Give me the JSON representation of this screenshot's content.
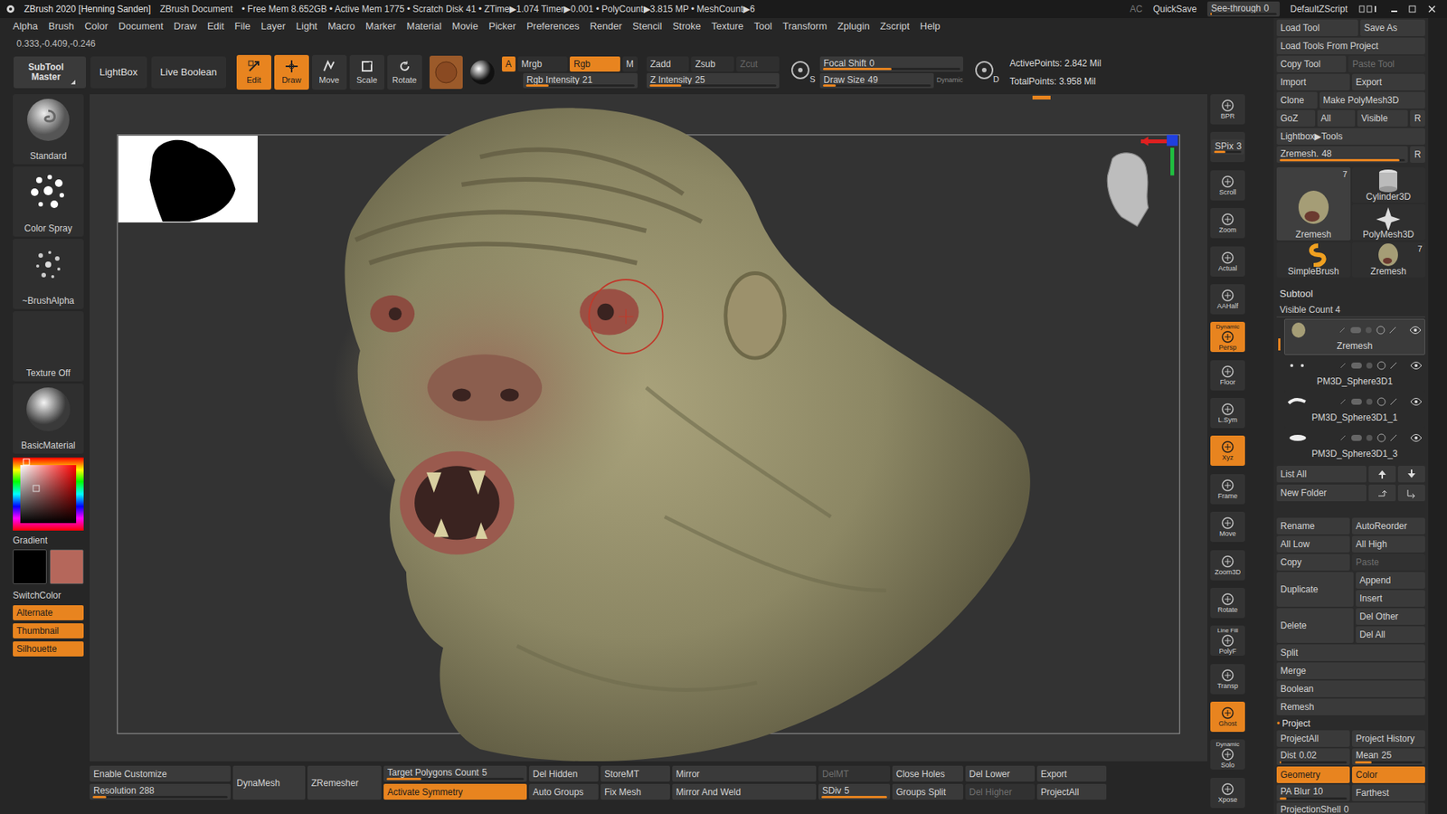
{
  "title_bar": {
    "app": "ZBrush 2020 [Henning Sanden]",
    "document": "ZBrush Document",
    "stats": "• Free Mem 8.652GB • Active Mem 1775 • Scratch Disk 41 • ZTime▶1.074 Timer▶0.001 • PolyCount▶3.815 MP • MeshCount▶6",
    "ac": "AC",
    "quicksave": "QuickSave",
    "see_through": {
      "label": "See-through",
      "value": "0",
      "level": 0
    },
    "script": "DefaultZScript"
  },
  "menu": [
    "Alpha",
    "Brush",
    "Color",
    "Document",
    "Draw",
    "Edit",
    "File",
    "Layer",
    "Light",
    "Macro",
    "Marker",
    "Material",
    "Movie",
    "Picker",
    "Preferences",
    "Render",
    "Stencil",
    "Stroke",
    "Texture",
    "Tool",
    "Transform",
    "Zplugin",
    "Zscript",
    "Help"
  ],
  "coordinates": "0.333,-0.409,-0.246",
  "top_shelf": {
    "palettes": [
      {
        "label": "SubTool Master"
      },
      {
        "label": "LightBox"
      },
      {
        "label": "Live Boolean"
      }
    ],
    "transform": [
      {
        "label": "Edit",
        "selected": true
      },
      {
        "label": "Draw",
        "selected": true
      },
      {
        "label": "Move",
        "selected": false
      },
      {
        "label": "Scale",
        "selected": false
      },
      {
        "label": "Rotate",
        "selected": false
      }
    ],
    "color_modes": [
      {
        "label": "A",
        "selected": true
      },
      {
        "label": "Mrgb",
        "selected": false
      },
      {
        "label": "Rgb",
        "selected": true
      },
      {
        "label": "M",
        "selected": false
      }
    ],
    "rgb_intensity": {
      "label": "Rgb Intensity",
      "value": "21",
      "level": 0.21
    },
    "depth_modes": [
      {
        "label": "Zadd",
        "selected": false,
        "disabled": false
      },
      {
        "label": "Zsub",
        "selected": false,
        "disabled": false
      },
      {
        "label": "Zcut",
        "selected": false,
        "disabled": true
      }
    ],
    "z_intensity": {
      "label": "Z Intensity",
      "value": "25",
      "level": 0.25
    },
    "focal_key": "S",
    "draw_key": "D",
    "focal_shift": {
      "label": "Focal Shift",
      "value": "0",
      "level": 0.5
    },
    "draw_size": {
      "label": "Draw Size",
      "value": "49",
      "level": 0.12
    },
    "dynamic": "Dynamic",
    "active_points": "ActivePoints: 2.842 Mil",
    "total_points": "TotalPoints: 3.958 Mil"
  },
  "left_shelf": {
    "brushes": [
      {
        "label": "Standard"
      },
      {
        "label": "Color Spray"
      },
      {
        "label": "~BrushAlpha"
      },
      {
        "label": "Texture Off"
      },
      {
        "label": "BasicMaterial"
      }
    ],
    "gradient": "Gradient",
    "swatches": [
      {
        "color": "#000000"
      },
      {
        "color": "#b5675b"
      }
    ],
    "switch_color": "SwitchColor",
    "toggles": [
      {
        "label": "Alternate",
        "on": true
      },
      {
        "label": "Thumbnail",
        "on": true
      },
      {
        "label": "Silhouette",
        "on": true
      }
    ]
  },
  "right_shelf": [
    {
      "label": "BPR",
      "caption": "",
      "kind": "button",
      "on": false
    },
    {
      "label": "SPix",
      "value": "3",
      "caption": "",
      "kind": "slider",
      "level": 0.43
    },
    {
      "label": "Scroll",
      "caption": "",
      "kind": "button",
      "on": false
    },
    {
      "label": "Zoom",
      "caption": "",
      "kind": "button",
      "on": false
    },
    {
      "label": "Actual",
      "caption": "",
      "kind": "button",
      "on": false
    },
    {
      "label": "AAHalf",
      "caption": "",
      "kind": "button",
      "on": false
    },
    {
      "label": "Persp",
      "caption": "Dynamic",
      "kind": "button",
      "on": true
    },
    {
      "label": "Floor",
      "caption": "",
      "kind": "button",
      "on": false
    },
    {
      "label": "L.Sym",
      "caption": "",
      "kind": "button",
      "on": false
    },
    {
      "label": "Xyz",
      "caption": "",
      "kind": "button",
      "on": true
    },
    {
      "label": "Frame",
      "caption": "",
      "kind": "button",
      "on": false
    },
    {
      "label": "Move",
      "caption": "",
      "kind": "button",
      "on": false
    },
    {
      "label": "Zoom3D",
      "caption": "",
      "kind": "button",
      "on": false
    },
    {
      "label": "Rotate",
      "caption": "",
      "kind": "button",
      "on": false
    },
    {
      "label": "PolyF",
      "caption": "Line Fill",
      "kind": "button",
      "on": false
    },
    {
      "label": "Transp",
      "caption": "",
      "kind": "button",
      "on": false
    },
    {
      "label": "Ghost",
      "caption": "",
      "kind": "button",
      "on": true
    },
    {
      "label": "Solo",
      "caption": "Dynamic",
      "kind": "button",
      "on": false
    },
    {
      "label": "Xpose",
      "caption": "",
      "kind": "button",
      "on": false
    }
  ],
  "tray": {
    "tool_rows": [
      {
        "items": [
          {
            "kind": "button",
            "label": "Load Tool"
          },
          {
            "kind": "button",
            "label": "Save As"
          }
        ]
      },
      {
        "items": [
          {
            "kind": "button",
            "label": "Load Tools From Project"
          }
        ]
      },
      {
        "items": [
          {
            "kind": "button",
            "label": "Copy Tool"
          },
          {
            "kind": "button",
            "label": "Paste Tool",
            "disabled": true
          }
        ]
      },
      {
        "items": [
          {
            "kind": "button",
            "label": "Import"
          },
          {
            "kind": "button",
            "label": "Export"
          }
        ]
      },
      {
        "items": [
          {
            "kind": "button",
            "label": "Clone"
          },
          {
            "kind": "button",
            "label": "Make PolyMesh3D"
          }
        ]
      },
      {
        "items": [
          {
            "kind": "button",
            "label": "GoZ"
          },
          {
            "kind": "button",
            "label": "All"
          },
          {
            "kind": "button",
            "label": "Visible"
          },
          {
            "kind": "button",
            "label": "R"
          }
        ]
      },
      {
        "items": [
          {
            "kind": "button",
            "label": "Lightbox▶Tools"
          }
        ]
      },
      {
        "items": [
          {
            "kind": "slider",
            "label": "Zremesh.",
            "value": "48",
            "level": 0.96
          },
          {
            "kind": "button",
            "label": "R"
          }
        ]
      }
    ],
    "tools": [
      {
        "label": "Zremesh",
        "count": "7",
        "selected": true
      },
      {
        "label": "Cylinder3D",
        "count": "",
        "selected": false
      },
      {
        "label": "PolyMesh3D",
        "count": "",
        "selected": false
      },
      {
        "label": "SimpleBrush",
        "count": "",
        "selected": false
      },
      {
        "label": "Zremesh",
        "count": "7",
        "selected": false
      }
    ],
    "subtool": {
      "title": "Subtool",
      "visible_count": "Visible Count 4",
      "items": [
        {
          "name": "Zremesh",
          "selected": true,
          "visible": true
        },
        {
          "name": "PM3D_Sphere3D1",
          "selected": false,
          "visible": true
        },
        {
          "name": "PM3D_Sphere3D1_1",
          "selected": false,
          "visible": true
        },
        {
          "name": "PM3D_Sphere3D1_3",
          "selected": false,
          "visible": true
        }
      ],
      "list_all": "List All",
      "new_folder": "New Folder",
      "actions": [
        {
          "layout": "pair",
          "items": [
            {
              "kind": "button",
              "label": "Rename"
            },
            {
              "kind": "button",
              "label": "AutoReorder"
            }
          ]
        },
        {
          "layout": "pair",
          "items": [
            {
              "kind": "button",
              "label": "All Low"
            },
            {
              "kind": "button",
              "label": "All High"
            }
          ]
        },
        {
          "layout": "pair",
          "items": [
            {
              "kind": "button",
              "label": "Copy"
            },
            {
              "kind": "button",
              "label": "Paste",
              "disabled": true
            }
          ]
        },
        {
          "layout": "tall",
          "items": [
            {
              "kind": "button",
              "label": "Duplicate"
            },
            {
              "kind": "button",
              "label": "Append"
            },
            {
              "kind": "button",
              "label": "Insert"
            }
          ]
        },
        {
          "layout": "tall",
          "items": [
            {
              "kind": "button",
              "label": "Delete"
            },
            {
              "kind": "button",
              "label": "Del Other"
            },
            {
              "kind": "button",
              "label": "Del All"
            }
          ]
        },
        {
          "layout": "single",
          "items": [
            {
              "kind": "button",
              "label": "Split"
            }
          ]
        },
        {
          "layout": "single",
          "items": [
            {
              "kind": "button",
              "label": "Merge"
            }
          ]
        },
        {
          "layout": "single",
          "items": [
            {
              "kind": "button",
              "label": "Boolean"
            }
          ]
        },
        {
          "layout": "single",
          "items": [
            {
              "kind": "button",
              "label": "Remesh"
            }
          ]
        }
      ]
    },
    "project": {
      "marker": "•",
      "title": "Project",
      "rows": [
        {
          "layout": "pair",
          "items": [
            {
              "kind": "button",
              "label": "ProjectAll"
            },
            {
              "kind": "button",
              "label": "Project History"
            }
          ]
        },
        {
          "layout": "pair",
          "items": [
            {
              "kind": "slider",
              "label": "Dist",
              "value": "0.02",
              "level": 0.02
            },
            {
              "kind": "slider",
              "label": "Mean",
              "value": "25",
              "level": 0.25
            }
          ]
        },
        {
          "layout": "pair",
          "items": [
            {
              "kind": "button",
              "label": "Geometry",
              "on": true
            },
            {
              "kind": "button",
              "label": "Color",
              "on": true
            }
          ]
        },
        {
          "layout": "pair",
          "items": [
            {
              "kind": "slider",
              "label": "PA Blur",
              "value": "10",
              "level": 0.1
            },
            {
              "kind": "button",
              "label": "Farthest"
            }
          ]
        },
        {
          "layout": "single",
          "items": [
            {
              "kind": "slider",
              "label": "ProjectionShell",
              "value": "0",
              "level": 0
            }
          ]
        }
      ]
    }
  },
  "bottom_bar": [
    {
      "items": [
        {
          "kind": "button",
          "label": "Enable Customize"
        },
        {
          "kind": "slider",
          "label": "Resolution",
          "value": "288",
          "level": 0.1
        }
      ]
    },
    {
      "items": [
        {
          "kind": "button",
          "label": "DynaMesh"
        }
      ]
    },
    {
      "items": [
        {
          "kind": "button",
          "label": "ZRemesher"
        }
      ]
    },
    {
      "items": [
        {
          "kind": "slider",
          "label": "Target Polygons Count",
          "value": "5",
          "level": 0.25
        },
        {
          "kind": "button",
          "label": "Activate Symmetry",
          "on": true
        }
      ]
    },
    {
      "items": [
        {
          "kind": "button",
          "label": "Del Hidden"
        },
        {
          "kind": "button",
          "label": "Auto Groups"
        }
      ]
    },
    {
      "items": [
        {
          "kind": "button",
          "label": "StoreMT"
        },
        {
          "kind": "button",
          "label": "Fix Mesh"
        }
      ]
    },
    {
      "items": [
        {
          "kind": "button",
          "label": "Mirror"
        },
        {
          "kind": "button",
          "label": "Mirror And Weld"
        }
      ]
    },
    {
      "items": [
        {
          "kind": "button",
          "label": "DelMT",
          "disabled": true
        },
        {
          "kind": "slider",
          "label": "SDiv",
          "value": "5",
          "level": 1
        }
      ]
    },
    {
      "items": [
        {
          "kind": "button",
          "label": "Close Holes"
        },
        {
          "kind": "button",
          "label": "Groups Split"
        }
      ]
    },
    {
      "items": [
        {
          "kind": "button",
          "label": "Del Lower"
        },
        {
          "kind": "button",
          "label": "Del Higher",
          "disabled": true
        }
      ]
    },
    {
      "items": [
        {
          "kind": "button",
          "label": "Export"
        },
        {
          "kind": "button",
          "label": "ProjectAll"
        }
      ]
    }
  ]
}
